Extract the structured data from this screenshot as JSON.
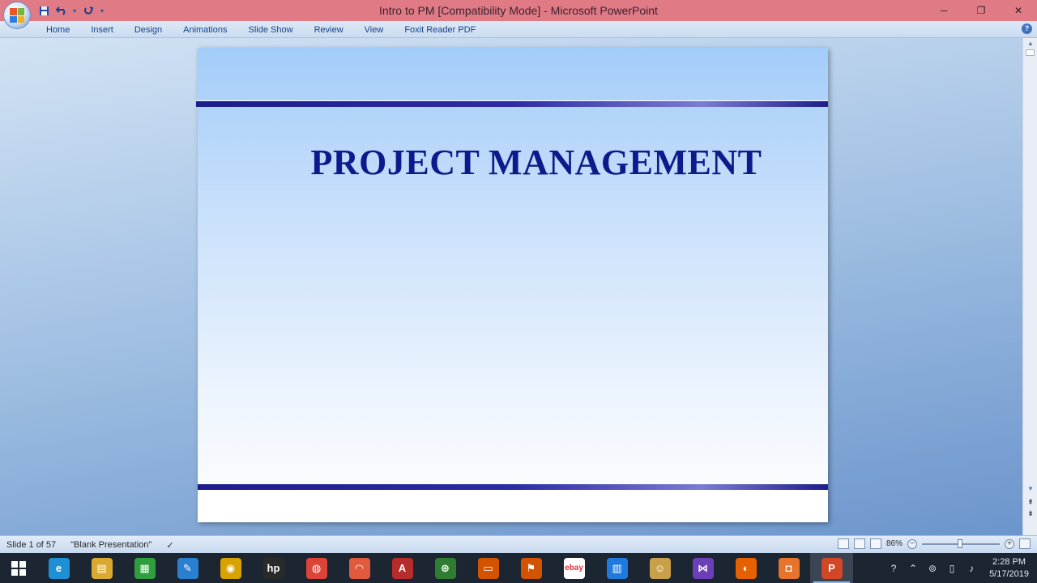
{
  "window": {
    "title": "Intro to PM [Compatibility Mode] - Microsoft PowerPoint",
    "controls": [
      "─",
      "❐",
      "✕"
    ]
  },
  "qat": {
    "save": "save-icon",
    "undo": "undo-icon",
    "redo": "redo-icon",
    "customize": "customize-qat-icon"
  },
  "ribbon": {
    "tabs": [
      "Home",
      "Insert",
      "Design",
      "Animations",
      "Slide Show",
      "Review",
      "View",
      "Foxit Reader PDF"
    ],
    "help": "?"
  },
  "slide": {
    "title": "PROJECT MANAGEMENT"
  },
  "status": {
    "slide_info": "Slide 1 of 57",
    "theme": "\"Blank Presentation\"",
    "zoom": "86%"
  },
  "taskbar": {
    "apps": [
      {
        "name": "internet-explorer-icon",
        "label": "e",
        "color": "#1e90d6"
      },
      {
        "name": "file-explorer-icon",
        "label": "▤",
        "color": "#d9a930"
      },
      {
        "name": "store-icon",
        "label": "▦",
        "color": "#2f9e3c"
      },
      {
        "name": "snipping-tool-icon",
        "label": "✎",
        "color": "#2a7fd0"
      },
      {
        "name": "media-player-icon",
        "label": "◉",
        "color": "#d8a300"
      },
      {
        "name": "hp-icon",
        "label": "hp",
        "color": "#2a2a2a"
      },
      {
        "name": "chrome-icon",
        "label": "◍",
        "color": "#dc4437"
      },
      {
        "name": "acrobat-icon",
        "label": "◠",
        "color": "#e25a3e"
      },
      {
        "name": "access-icon",
        "label": "A",
        "color": "#b62b2b"
      },
      {
        "name": "globe-icon",
        "label": "⊕",
        "color": "#2e7d32"
      },
      {
        "name": "powerpoint-viewer-icon",
        "label": "▭",
        "color": "#d35400"
      },
      {
        "name": "pdf-tool-icon",
        "label": "⚑",
        "color": "#d35400"
      },
      {
        "name": "ebay-icon",
        "label": "ebay",
        "color": "#ffffff"
      },
      {
        "name": "audio-meter-icon",
        "label": "▥",
        "color": "#1f7ae0"
      },
      {
        "name": "mascot-icon",
        "label": "☺",
        "color": "#c8a04a"
      },
      {
        "name": "visual-studio-icon",
        "label": "⋈",
        "color": "#6b3fb5"
      },
      {
        "name": "firefox-icon",
        "label": "◐",
        "color": "#e66000"
      },
      {
        "name": "slides-icon",
        "label": "◘",
        "color": "#e6742a"
      },
      {
        "name": "powerpoint-icon",
        "label": "P",
        "color": "#d24726",
        "active": true
      }
    ],
    "tray": [
      "help-icon",
      "chevron-up-icon",
      "sync-icon",
      "tablet-icon",
      "volume-icon"
    ],
    "time": "2:28 PM",
    "date": "5/17/2019"
  }
}
